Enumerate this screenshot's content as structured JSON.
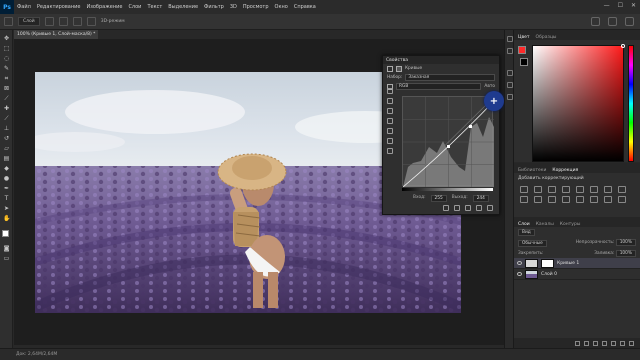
{
  "app": {
    "logo": "Ps"
  },
  "menu": [
    "Файл",
    "Редактирование",
    "Изображение",
    "Слои",
    "Текст",
    "Выделение",
    "Фильтр",
    "3D",
    "Просмотр",
    "Окно",
    "Справка"
  ],
  "window_controls": [
    "—",
    "☐",
    "✕"
  ],
  "options_bar": {
    "sample_label": "Слой",
    "extra_label": "3D-режим"
  },
  "document": {
    "tab_title": "100% (Кривые 1, Слой-маска/8) *"
  },
  "color_panel": {
    "tabs": [
      "Цвет",
      "Образцы"
    ],
    "fg_color": "#ff2a2a"
  },
  "adjustments_panel": {
    "tabs": [
      "Библиотеки",
      "Коррекция"
    ],
    "title": "Добавить корректирующий"
  },
  "layers_panel": {
    "tabs": [
      "Слои",
      "Каналы",
      "Контуры"
    ],
    "kind_label": "Вид",
    "blend_mode": "Обычные",
    "opacity_label": "Непрозрачность:",
    "opacity_value": "100%",
    "lock_label": "Закрепить:",
    "fill_label": "Заливка:",
    "fill_value": "100%",
    "layers": [
      {
        "name": "Кривые 1",
        "selected": true
      },
      {
        "name": "Слой 0",
        "selected": false
      }
    ]
  },
  "properties_panel": {
    "title": "Свойства",
    "subtitle": "Кривые",
    "preset_label": "Набор:",
    "preset_value": "Заказная",
    "channel_value": "RGB",
    "auto_label": "Авто",
    "input_label": "Вход:",
    "input_value": "255",
    "output_label": "Выход:",
    "output_value": "244"
  },
  "status_bar": {
    "text": "Док: 2,64M/2,64M"
  },
  "colors": {
    "accent": "#31a8ff",
    "cursor": "#1f3b8f",
    "panel": "#2e2e2e"
  }
}
